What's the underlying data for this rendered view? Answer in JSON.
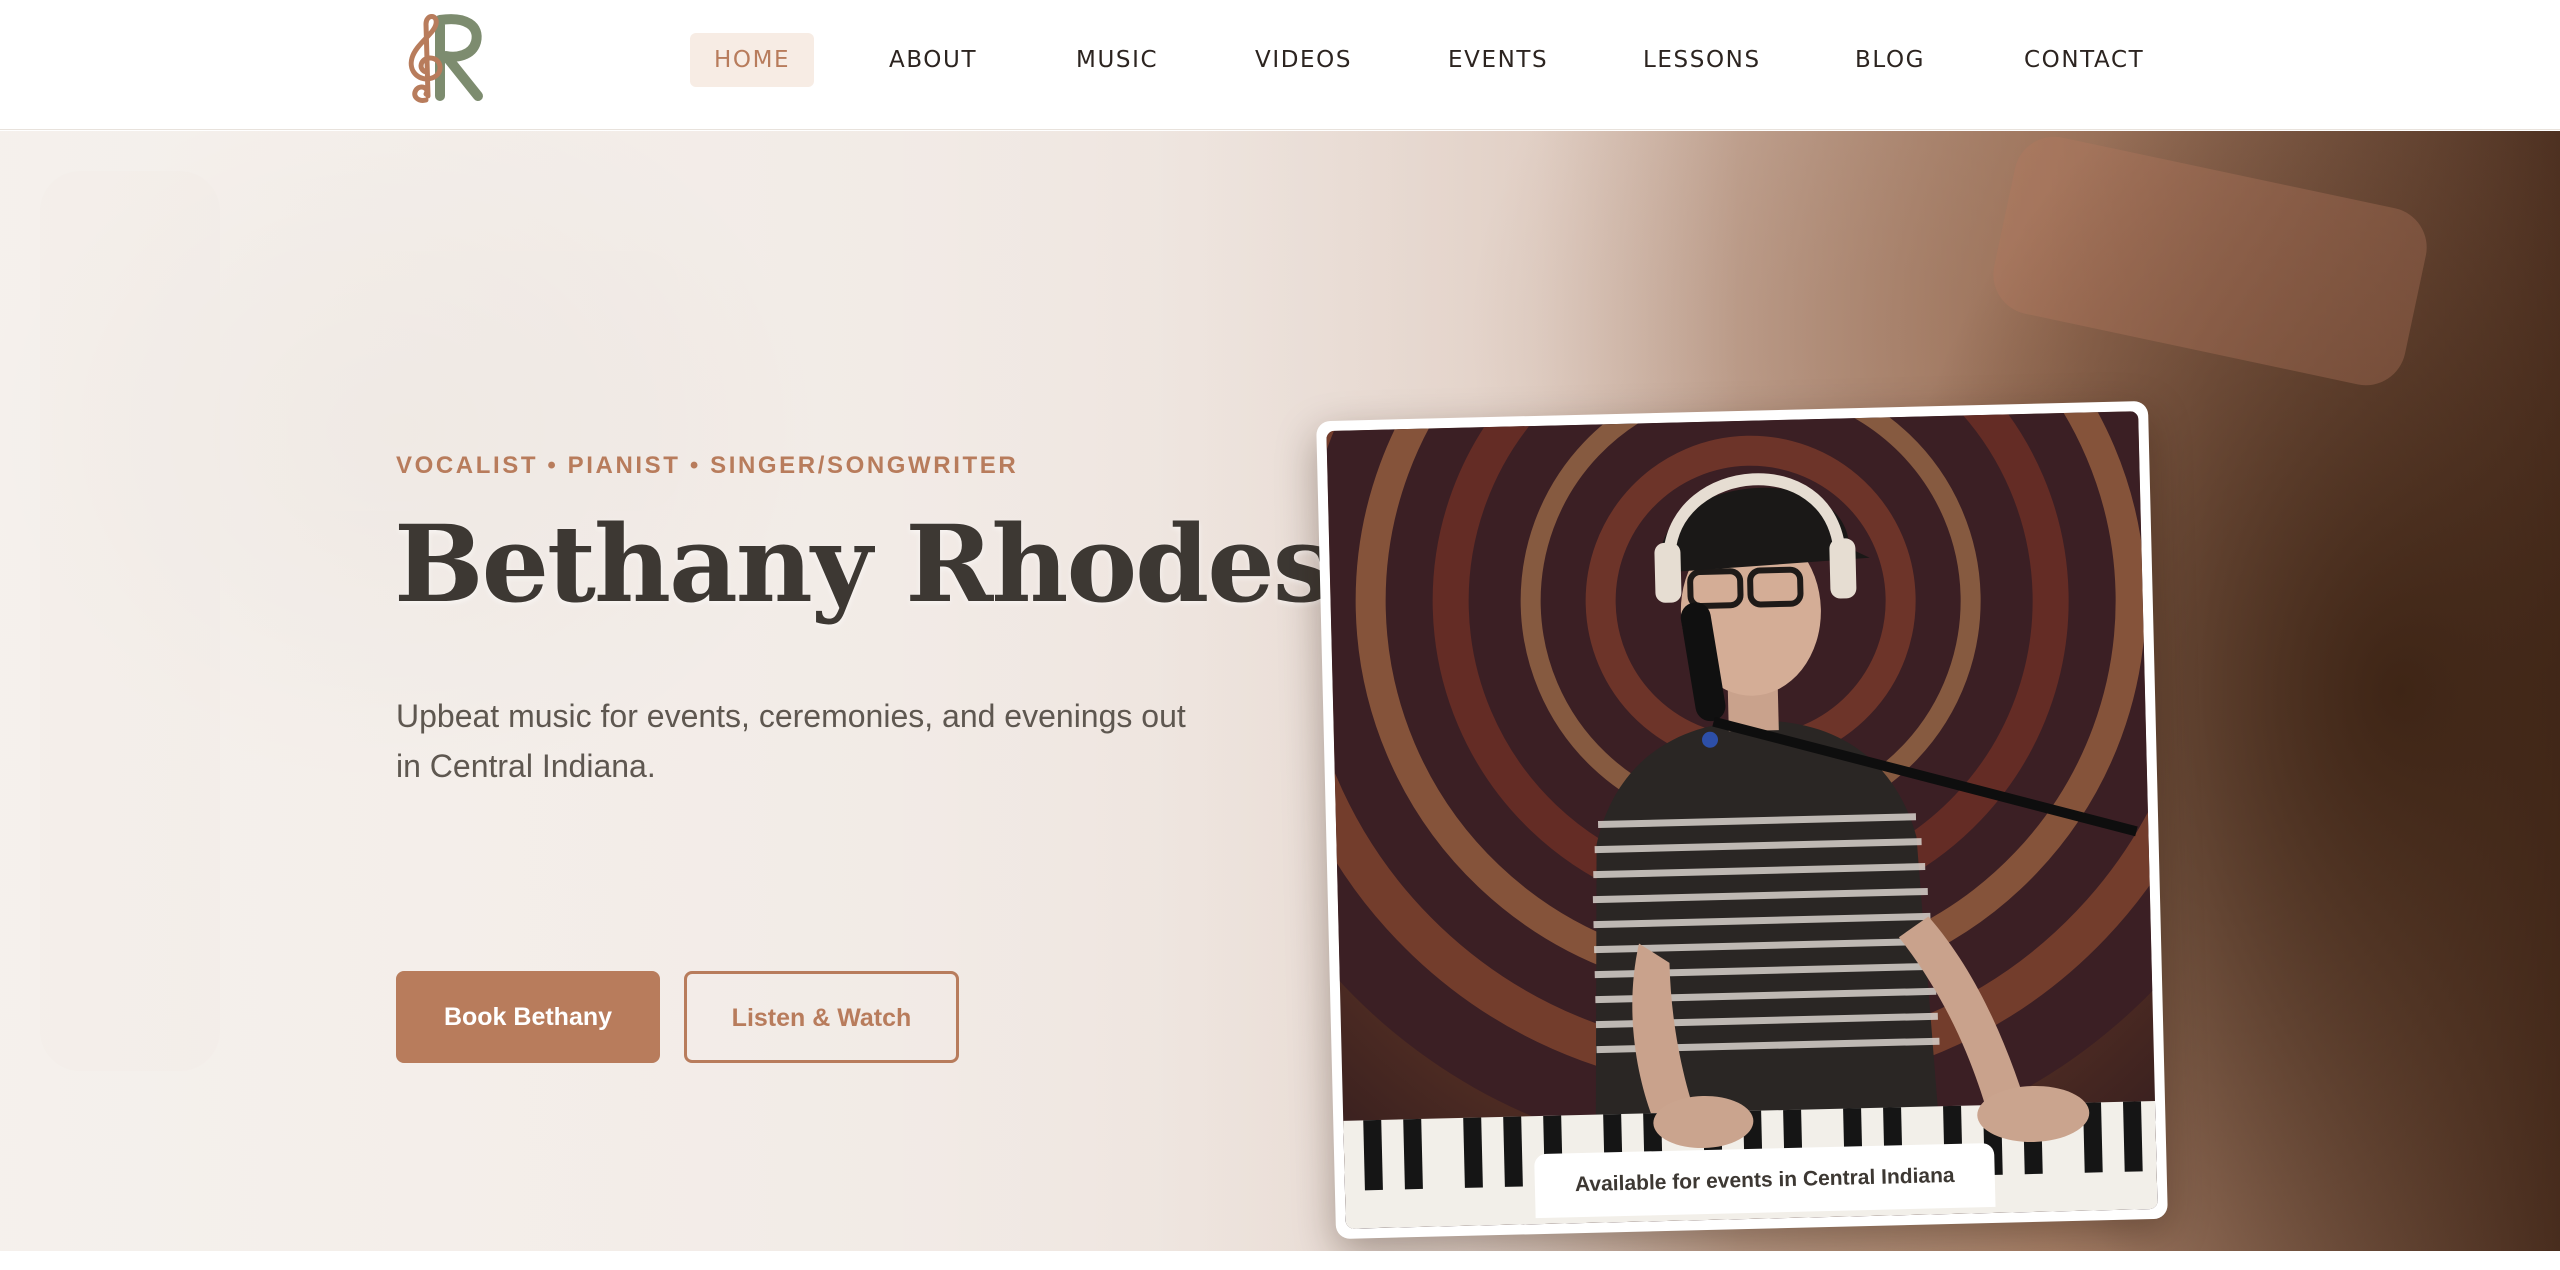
{
  "header": {
    "logo_alt": "Bethany Rhodes treble clef monogram",
    "nav": [
      {
        "label": "HOME",
        "active": true
      },
      {
        "label": "ABOUT",
        "active": false
      },
      {
        "label": "MUSIC",
        "active": false
      },
      {
        "label": "VIDEOS",
        "active": false
      },
      {
        "label": "EVENTS",
        "active": false
      },
      {
        "label": "LESSONS",
        "active": false
      },
      {
        "label": "BLOG",
        "active": false
      },
      {
        "label": "CONTACT",
        "active": false
      }
    ]
  },
  "hero": {
    "tagline": "VOCALIST • PIANIST • SINGER/SONGWRITER",
    "title": "Bethany Rhodes",
    "subtitle": "Upbeat music for events, ceremonies, and evenings out in Central Indiana.",
    "primary_button": "Book Bethany",
    "secondary_button": "Listen & Watch",
    "photo_caption": "Available for events in Central Indiana"
  },
  "colors": {
    "accent": "#b87c5c",
    "title": "#3d3833",
    "nav_active_bg": "#f7ece4",
    "logo_green": "#7d8c6f"
  },
  "icons": {
    "logo": "treble-clef-monogram-icon"
  }
}
